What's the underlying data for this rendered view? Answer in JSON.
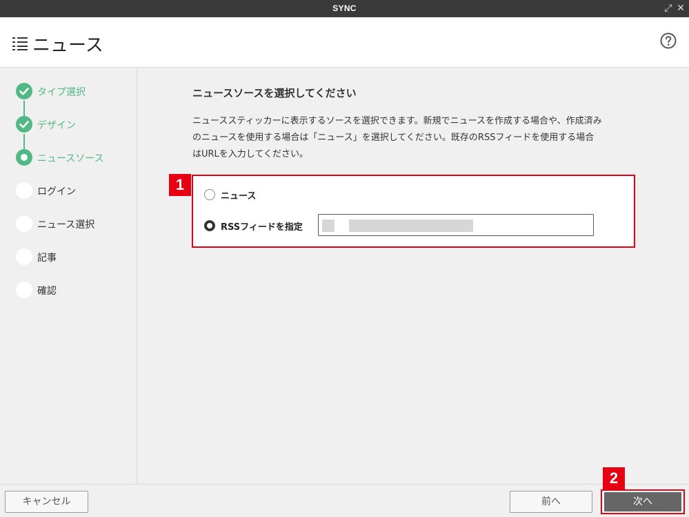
{
  "window": {
    "title": "SYNC",
    "icons": [
      "expand-icon",
      "close-icon"
    ]
  },
  "header": {
    "title": "ニュース",
    "menu_icon": "list-icon",
    "help_icon": "help-icon"
  },
  "steps": [
    {
      "label": "タイプ選択",
      "state": "done"
    },
    {
      "label": "デザイン",
      "state": "done"
    },
    {
      "label": "ニュースソース",
      "state": "current"
    },
    {
      "label": "ログイン",
      "state": "pending"
    },
    {
      "label": "ニュース選択",
      "state": "pending"
    },
    {
      "label": "記事",
      "state": "pending"
    },
    {
      "label": "確認",
      "state": "pending"
    }
  ],
  "main": {
    "section_title": "ニュースソースを選択してください",
    "description_lines": [
      "ニューススティッカーに表示するソースを選択できます。新規でニュースを作成する場合や、作成済み",
      "のニュースを使用する場合は「ニュース」を選択してください。既存のRSSフィードを使用する場合",
      "はURLを入力してください。"
    ],
    "options": [
      {
        "label": "ニュース",
        "checked": false
      },
      {
        "label": "RSSフィードを指定",
        "checked": true
      }
    ],
    "rss_url_value": ""
  },
  "annotations": {
    "badge1": "1",
    "badge2": "2"
  },
  "footer": {
    "cancel_label": "キャンセル",
    "prev_label": "前へ",
    "next_label": "次へ"
  },
  "colors": {
    "accent_green": "#52b986",
    "highlight_red": "#e60012",
    "titlebar": "#3a3a3a",
    "next_button": "#666666"
  }
}
